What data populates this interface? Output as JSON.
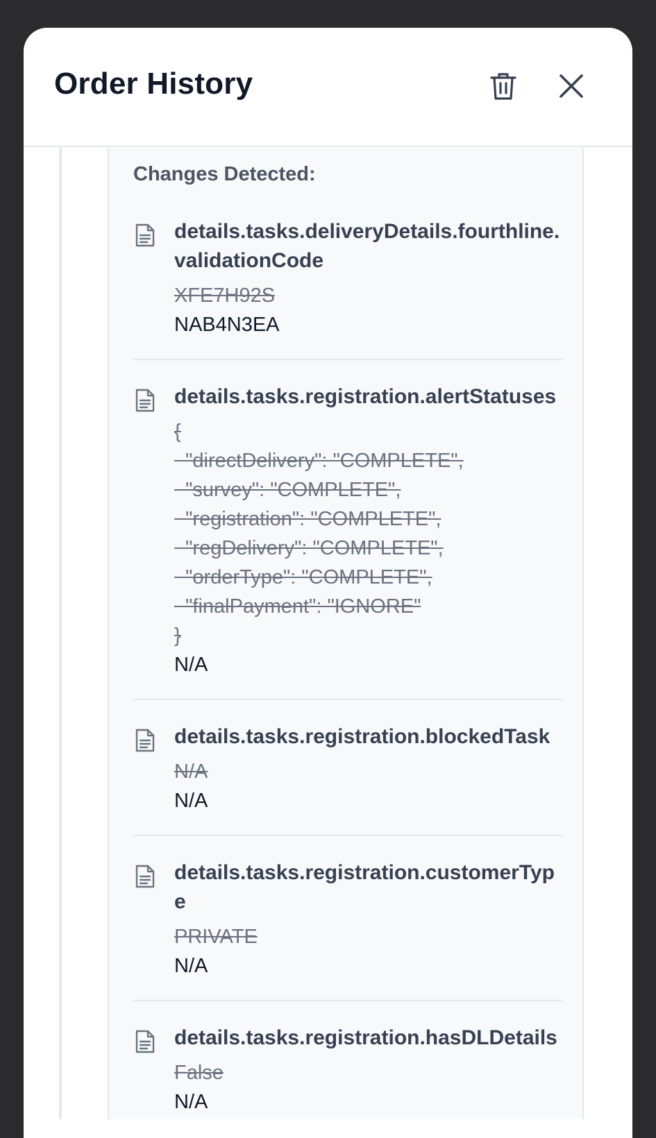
{
  "modal": {
    "title": "Order History"
  },
  "changes": {
    "heading": "Changes Detected:",
    "items": [
      {
        "field": "details.tasks.deliveryDetails.fourthline.validationCode",
        "old_value": "XFE7H92S",
        "new_value": "NAB4N3EA"
      },
      {
        "field": "details.tasks.registration.alertStatuses",
        "old_value": "{\n  \"directDelivery\": \"COMPLETE\",\n  \"survey\": \"COMPLETE\",\n  \"registration\": \"COMPLETE\",\n  \"regDelivery\": \"COMPLETE\",\n  \"orderType\": \"COMPLETE\",\n  \"finalPayment\": \"IGNORE\"\n}",
        "new_value": "N/A"
      },
      {
        "field": "details.tasks.registration.blockedTask",
        "old_value": "N/A",
        "new_value": "N/A"
      },
      {
        "field": "details.tasks.registration.customerType",
        "old_value": "PRIVATE",
        "new_value": "N/A"
      },
      {
        "field": "details.tasks.registration.hasDLDetails",
        "old_value": "False",
        "new_value": "N/A"
      }
    ]
  }
}
